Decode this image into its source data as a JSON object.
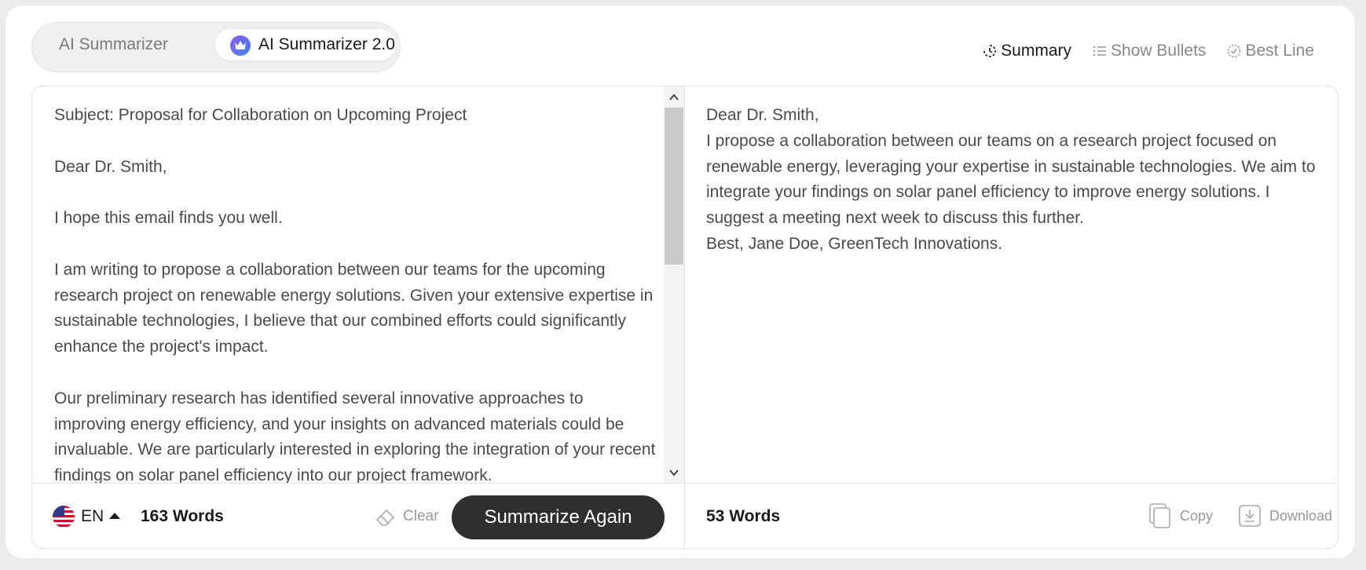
{
  "tabs": [
    {
      "label": "AI Summarizer",
      "active": false
    },
    {
      "label": "AI Summarizer 2.0",
      "active": true,
      "icon": "crown-icon"
    }
  ],
  "modes": [
    {
      "label": "Summary",
      "icon": "summary-icon",
      "active": true
    },
    {
      "label": "Show Bullets",
      "icon": "bullets-icon",
      "active": false
    },
    {
      "label": "Best Line",
      "icon": "best-line-icon",
      "active": false
    }
  ],
  "input": {
    "text": "Subject: Proposal for Collaboration on Upcoming Project\n\nDear Dr. Smith,\n\nI hope this email finds you well.\n\nI am writing to propose a collaboration between our teams for the upcoming research project on renewable energy solutions. Given your extensive expertise in sustainable technologies, I believe that our combined efforts could significantly enhance the project's impact.\n\nOur preliminary research has identified several innovative approaches to improving energy efficiency, and your insights on advanced materials could be invaluable. We are particularly interested in exploring the integration of your recent findings on solar panel efficiency into our project framework.",
    "language": "EN",
    "language_flag": "us-flag-icon",
    "word_count": "163 Words",
    "clear_label": "Clear",
    "summarize_label": "Summarize Again"
  },
  "output": {
    "lines": [
      "Dear Dr. Smith,",
      "I propose a collaboration between our teams on a research project focused on renewable energy, leveraging your expertise in sustainable technologies. We aim to integrate your findings on solar panel efficiency to improve energy solutions. I suggest a meeting next week to discuss this further.",
      "Best, Jane Doe, GreenTech Innovations."
    ],
    "word_count": "53 Words",
    "copy_label": "Copy",
    "download_label": "Download"
  },
  "colors": {
    "accent_button": "#2f2f2f",
    "tab_icon_gradient": [
      "#8b5cf6",
      "#3b82f6"
    ],
    "text": "#4a4a4a",
    "muted": "#999999"
  }
}
